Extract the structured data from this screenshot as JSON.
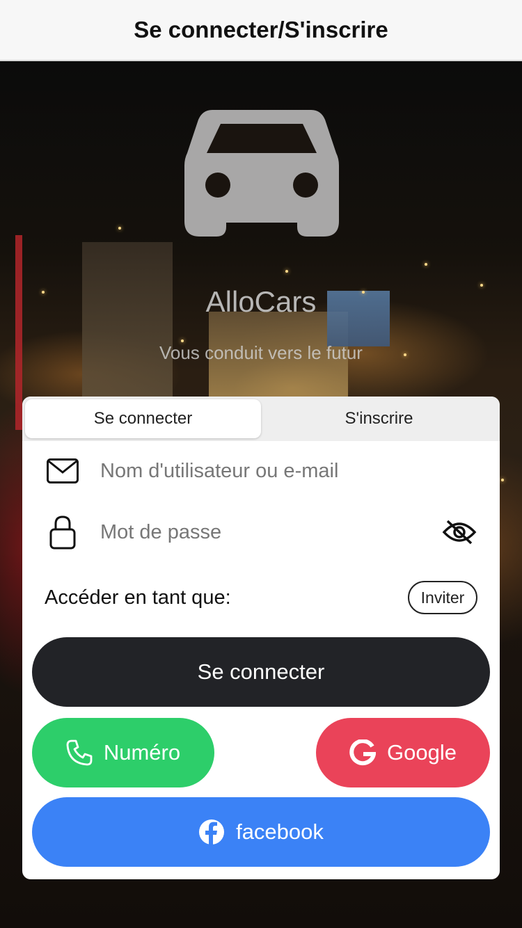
{
  "header": {
    "title": "Se connecter/S'inscrire"
  },
  "hero": {
    "app_name": "AlloCars",
    "tagline": "Vous conduit vers le futur",
    "logo_icon": "car-icon"
  },
  "tabs": [
    {
      "label": "Se connecter",
      "active": true
    },
    {
      "label": "S'inscrire",
      "active": false
    }
  ],
  "form": {
    "username": {
      "placeholder": "Nom d'utilisateur ou e-mail",
      "value": "",
      "icon": "envelope-icon"
    },
    "password": {
      "placeholder": "Mot de passe",
      "value": "",
      "icon": "lock-icon",
      "toggle_icon": "eye-slash-icon"
    },
    "access": {
      "label": "Accéder en tant que:",
      "invite_label": "Inviter"
    }
  },
  "buttons": {
    "login": "Se connecter",
    "phone": "Numéro",
    "google": "Google",
    "facebook": "facebook"
  },
  "colors": {
    "login": "#222327",
    "phone": "#2dce6a",
    "google": "#ea4359",
    "facebook": "#3b82f6"
  }
}
